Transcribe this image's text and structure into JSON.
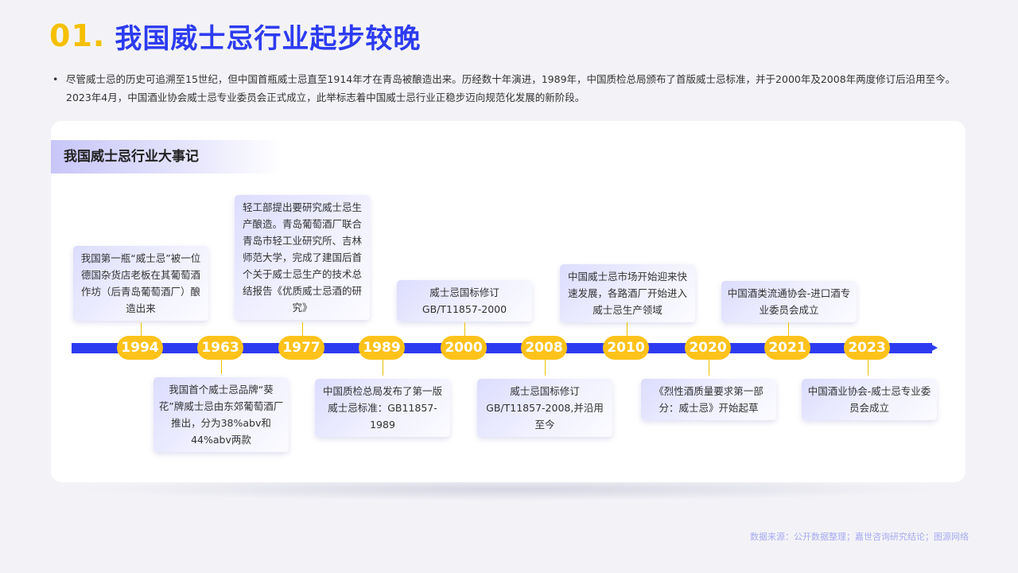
{
  "header": {
    "number": "01.",
    "title": "我国威士忌行业起步较晚"
  },
  "intro": {
    "bullet": "•",
    "text": "尽管威士忌的历史可追溯至15世纪，但中国首瓶威士忌直至1914年才在青岛被酿造出来。历经数十年演进，1989年，中国质检总局颁布了首版威士忌标准，并于2000年及2008年两度修订后沿用至今。2023年4月，中国酒业协会威士忌专业委员会正式成立，此举标志着中国威士忌行业正稳步迈向规范化发展的新阶段。"
  },
  "section": {
    "title": "我国威士忌行业大事记"
  },
  "timeline": [
    {
      "year": "1994",
      "text": "我国第一瓶“威士忌”被一位德国杂货店老板在其葡萄酒作坊（后青岛葡萄酒厂）酿造出来"
    },
    {
      "year": "1963",
      "text": "我国首个威士忌品牌“葵花”牌威士忌由东郊葡萄酒厂推出，分为38%abv和44%abv两款"
    },
    {
      "year": "1977",
      "text": "轻工部提出要研究威士忌生产酿造。青岛葡萄酒厂联合青岛市轻工业研究所、吉林师范大学，完成了建国后首个关于威士忌生产的技术总结报告《优质威士忌酒的研究》"
    },
    {
      "year": "1989",
      "text": "中国质检总局发布了第一版威士忌标准：GB11857-1989"
    },
    {
      "year": "2000",
      "text": "威士忌国标修订GB/T11857-2000"
    },
    {
      "year": "2008",
      "text": "威士忌国标修订GB/T11857-2008,并沿用至今"
    },
    {
      "year": "2010",
      "text": "中国威士忌市场开始迎来快速发展，各路酒厂开始进入威士忌生产领域"
    },
    {
      "year": "2020",
      "text": "《烈性酒质量要求第一部分：威士忌》开始起草"
    },
    {
      "year": "2021",
      "text": "中国酒类流通协会-进口酒专业委员会成立"
    },
    {
      "year": "2023",
      "text": "中国酒业协会-威士忌专业委员会成立"
    }
  ],
  "footer": {
    "source": "数据来源：公开数据整理；嘉世咨询研究结论；图源网络"
  },
  "colors": {
    "accent_blue": "#2d3bf0",
    "accent_yellow": "#ffc21a"
  }
}
